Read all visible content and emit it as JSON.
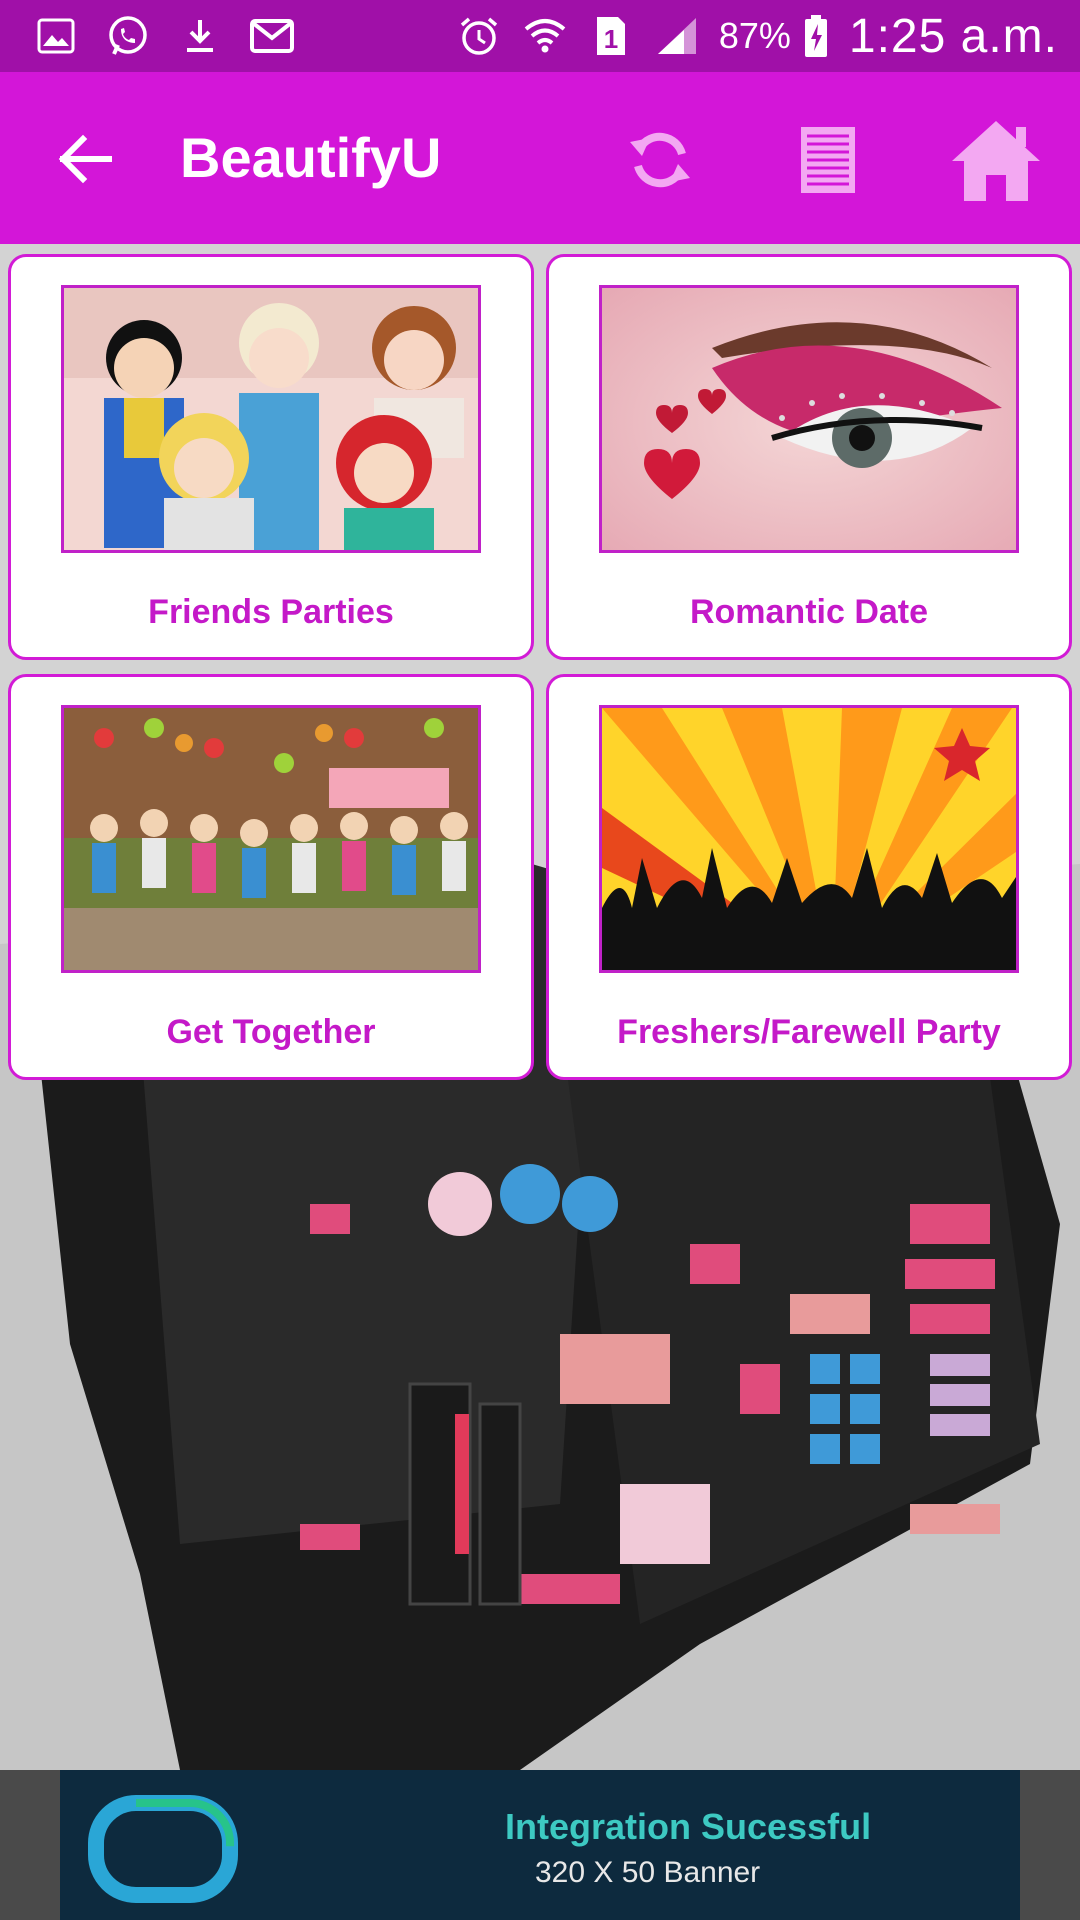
{
  "status_bar": {
    "battery_percent": "87%",
    "time": "1:25 a.m.",
    "sim_slot": "1",
    "icons_left": [
      "gallery-icon",
      "whatsapp-icon",
      "download-icon",
      "gmail-icon"
    ],
    "icons_right": [
      "alarm-icon",
      "wifi-icon",
      "sim-icon",
      "signal-icon",
      "battery-charging-icon"
    ]
  },
  "app_bar": {
    "title": "BeautifyU",
    "icons": [
      "back-arrow-icon",
      "refresh-icon",
      "list-icon",
      "home-icon"
    ]
  },
  "colors": {
    "status_bar": "#a010a8",
    "app_bar": "#d316d8",
    "accent": "#c419c8"
  },
  "categories": [
    {
      "label": "Friends Parties"
    },
    {
      "label": "Romantic Date"
    },
    {
      "label": "Get Together"
    },
    {
      "label": "Freshers/Farewell Party"
    }
  ],
  "ad": {
    "title": "Integration Sucessful",
    "subtitle": "320 X 50 Banner"
  }
}
